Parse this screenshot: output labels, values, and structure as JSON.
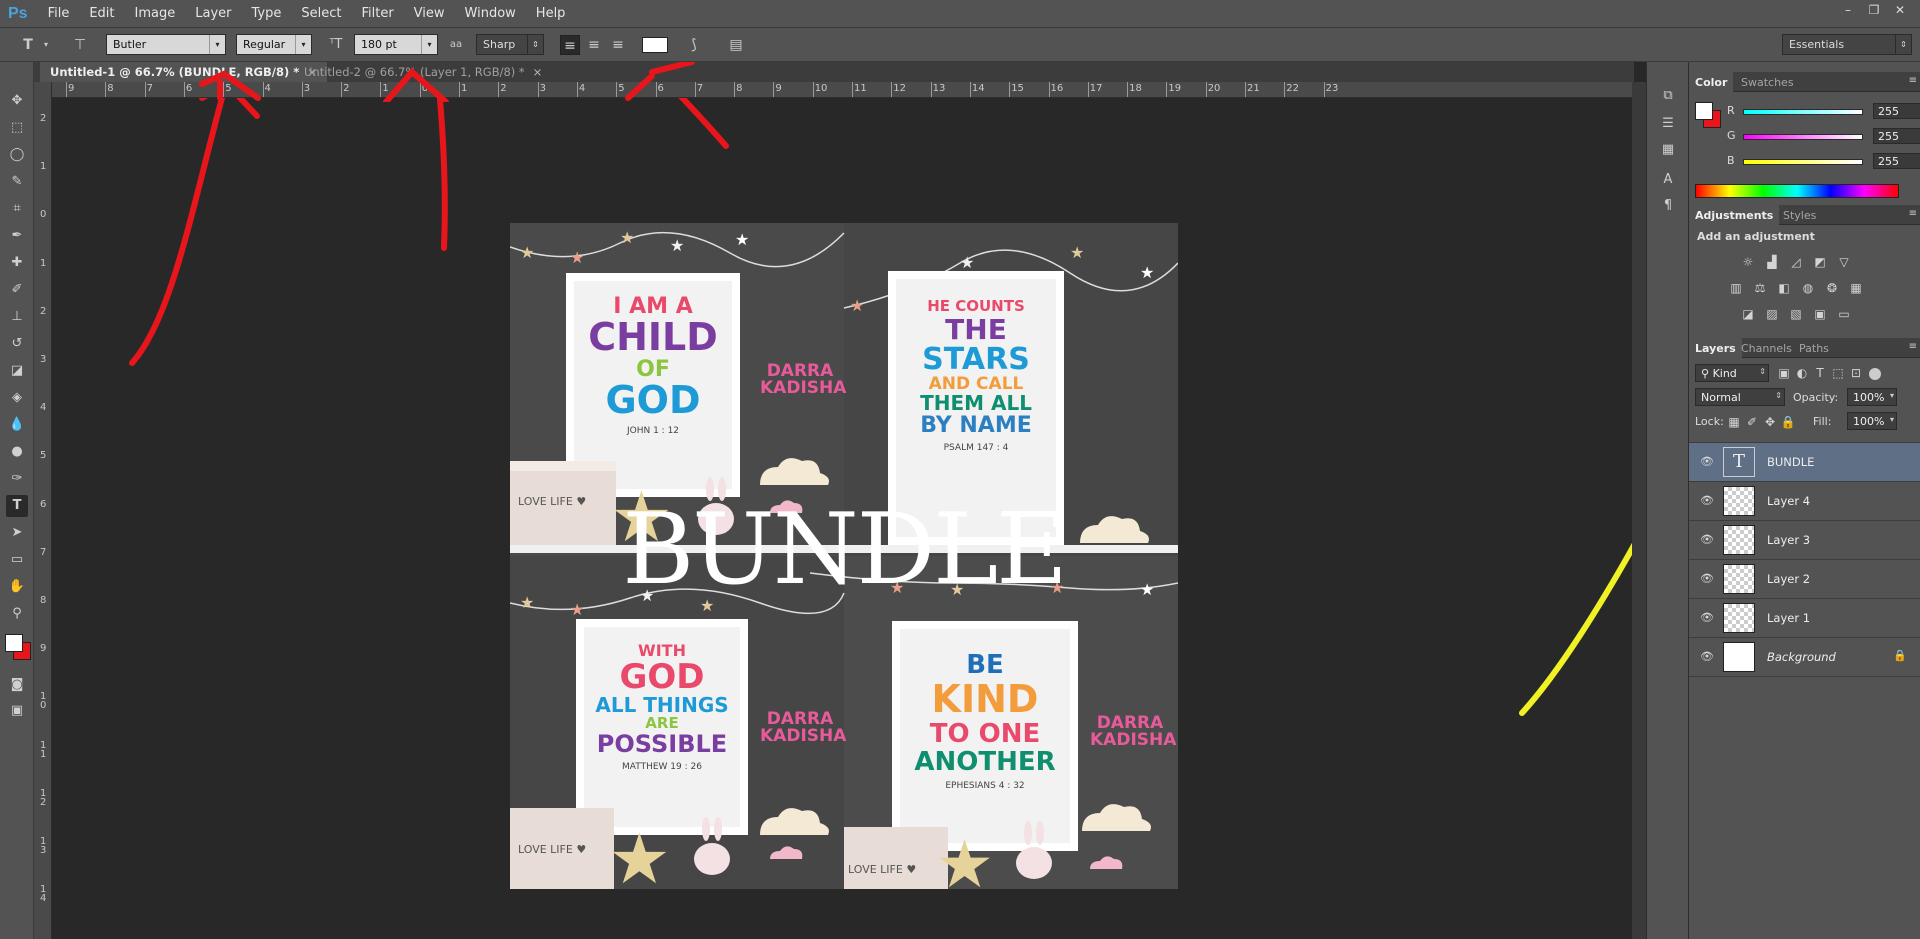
{
  "app": {
    "logo": "Ps"
  },
  "menu": [
    "File",
    "Edit",
    "Image",
    "Layer",
    "Type",
    "Select",
    "Filter",
    "View",
    "Window",
    "Help"
  ],
  "window_controls": [
    "–",
    "❐",
    "✕"
  ],
  "options": {
    "font_family": "Butler",
    "font_style": "Regular",
    "font_size": "180 pt",
    "antialias_icon": "aa",
    "antialias": "Sharp",
    "text_color": "#ffffff",
    "workspace": "Essentials"
  },
  "tabs": [
    {
      "label": "Untitled-1 @ 66.7% (BUNDLE, RGB/8) *",
      "close": "×"
    },
    {
      "label": "Untitled-2 @ 66.7% (Layer 1, RGB/8) *",
      "close": "×"
    }
  ],
  "ruler": {
    "h": [
      "9",
      "8",
      "7",
      "6",
      "5",
      "4",
      "3",
      "2",
      "1",
      "0",
      "1",
      "2",
      "3",
      "4",
      "5",
      "6",
      "7",
      "8",
      "9",
      "10",
      "11",
      "12",
      "13",
      "14",
      "15",
      "16",
      "17",
      "18",
      "19",
      "20",
      "21",
      "22",
      "23"
    ],
    "v": [
      "2",
      "1",
      "0",
      "1",
      "2",
      "3",
      "4",
      "5",
      "6",
      "7",
      "8",
      "9",
      "1\n0",
      "1\n1",
      "1\n2",
      "1\n3",
      "1\n4"
    ]
  },
  "color_panel": {
    "tabs": [
      "Color",
      "Swatches"
    ],
    "channels": [
      {
        "label": "R",
        "value": "255"
      },
      {
        "label": "G",
        "value": "255"
      },
      {
        "label": "B",
        "value": "255"
      }
    ]
  },
  "adjustments_panel": {
    "tabs": [
      "Adjustments",
      "Styles"
    ],
    "heading": "Add an adjustment"
  },
  "layers_panel": {
    "tabs": [
      "Layers",
      "Channels",
      "Paths"
    ],
    "filter": "Kind",
    "blend_mode": "Normal",
    "opacity_label": "Opacity:",
    "opacity": "100%",
    "lock_label": "Lock:",
    "fill_label": "Fill:",
    "fill": "100%",
    "layers": [
      {
        "name": "BUNDLE",
        "type": "text"
      },
      {
        "name": "Layer 4",
        "type": "image"
      },
      {
        "name": "Layer 3",
        "type": "image"
      },
      {
        "name": "Layer 2",
        "type": "image"
      },
      {
        "name": "Layer 1",
        "type": "image"
      },
      {
        "name": "Background",
        "type": "background"
      }
    ]
  },
  "document": {
    "overlay_text": "BUNDLE",
    "watermark": "DARRA\nKADISHA",
    "box_text": "LOVE LIFE ♥",
    "posters": [
      {
        "lines": [
          "I AM A",
          "CHILD",
          "OF",
          "GOD"
        ],
        "ref": "JOHN 1 : 12"
      },
      {
        "lines": [
          "HE COUNTS",
          "THE",
          "STARS",
          "AND CALL",
          "THEM ALL",
          "BY NAME"
        ],
        "ref": "PSALM 147 : 4"
      },
      {
        "lines": [
          "WITH",
          "GOD",
          "ALL THINGS",
          "ARE",
          "POSSIBLE"
        ],
        "ref": "MATTHEW 19 : 26"
      },
      {
        "lines": [
          "BE",
          "KIND",
          "TO ONE",
          "ANOTHER"
        ],
        "ref": "EPHESIANS 4 : 32"
      }
    ]
  },
  "annotation_colors": {
    "red": "#e8161b",
    "yellow": "#f1f223"
  }
}
